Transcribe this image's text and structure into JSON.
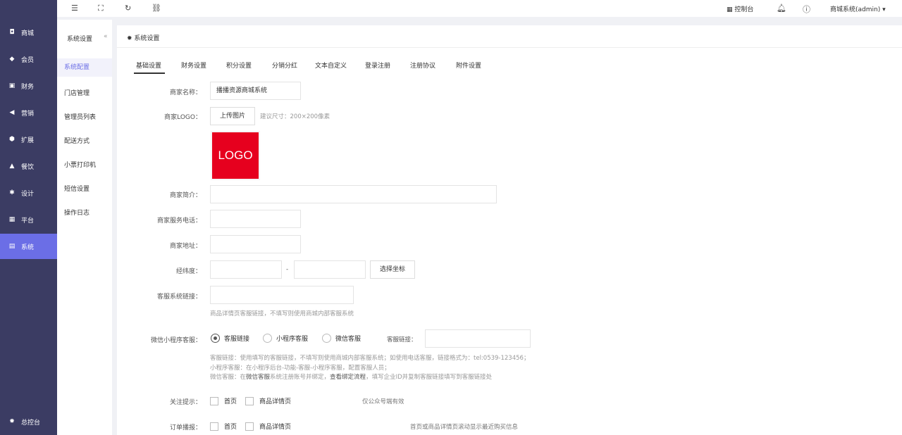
{
  "nav": [
    {
      "label": "商城",
      "icon": "shop-icon"
    },
    {
      "label": "会员",
      "icon": "diamond-icon"
    },
    {
      "label": "财务",
      "icon": "wallet-icon"
    },
    {
      "label": "营销",
      "icon": "megaphone-icon"
    },
    {
      "label": "扩展",
      "icon": "cube-icon"
    },
    {
      "label": "餐饮",
      "icon": "food-icon"
    },
    {
      "label": "设计",
      "icon": "puzzle-icon"
    },
    {
      "label": "平台",
      "icon": "grid-icon"
    },
    {
      "label": "系统",
      "icon": "system-icon"
    }
  ],
  "nav_bottom": {
    "label": "总控台",
    "icon": "gear-icon"
  },
  "subnav": {
    "title": "系统设置",
    "collapse": "«",
    "items": [
      "系统配置",
      "门店管理",
      "管理员列表",
      "配送方式",
      "小票打印机",
      "短信设置",
      "操作日志"
    ]
  },
  "topbar": {
    "console": "控制台",
    "account": "商城系统(admin)",
    "caret": "▾"
  },
  "breadcrumb": "系统设置",
  "tabs": [
    "基础设置",
    "财务设置",
    "积分设置",
    "分销分红",
    "文本自定义",
    "登录注册",
    "注册协议",
    "附件设置"
  ],
  "form": {
    "name_label": "商家名称：",
    "name_value": "播播资源商城系统",
    "logo_label": "商家LOGO：",
    "upload_btn": "上传图片",
    "logo_hint": "建议尺寸：200×200像素",
    "logo_text": "LOGO",
    "intro_label": "商家简介：",
    "phone_label": "商家服务电话：",
    "address_label": "商家地址：",
    "coord_label": "经纬度：",
    "coord_sep": "-",
    "coord_btn": "选择坐标",
    "cs_label": "客服系统链接：",
    "cs_hint": "商品详情页客服链接，不填写则使用商城内部客服系统",
    "wx_label": "微信小程序客服：",
    "wx_options": [
      "客服链接",
      "小程序客服",
      "微信客服"
    ],
    "wx_link_label": "客服链接：",
    "wx_hint1": "客服链接：使用填写的客服链接，不填写则使用商城内部客服系统；如使用电话客服，链接格式为：tel:0539-123456；",
    "wx_hint2": "小程序客服：在小程序后台-功能-客服-小程序客服，配置客服人员；",
    "wx_hint3_a": "微信客服：在",
    "wx_hint3_b": "微信客服",
    "wx_hint3_c": "系统注册账号并绑定，",
    "wx_hint3_d": "查看绑定流程",
    "wx_hint3_e": "，填写企业ID并复制客服链接填写到客服链接处",
    "follow_label": "关注提示：",
    "follow_opts": [
      "首页",
      "商品详情页"
    ],
    "follow_hint": "仅公众号端有效",
    "order_label": "订单播报：",
    "order_opts": [
      "首页",
      "商品详情页"
    ],
    "order_hint": "首页或商品详情页滚动显示最近购买信息"
  }
}
